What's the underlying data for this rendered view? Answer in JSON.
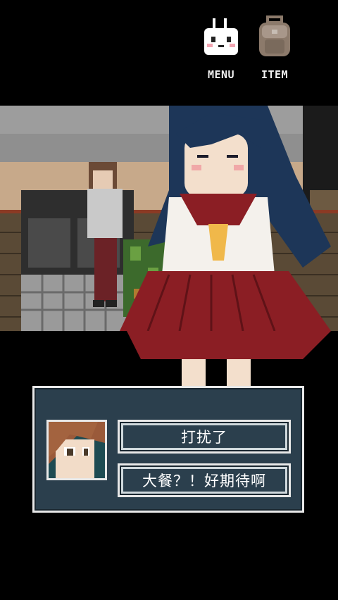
{
  "menu": {
    "label": "MENU"
  },
  "item": {
    "label": "ITEM"
  },
  "dialog": {
    "choices": [
      "打扰了",
      "大餐？！好期待啊"
    ]
  },
  "colors": {
    "panel": "#2b3f4d",
    "panel_border": "#e8e8e8",
    "skirt": "#8b1e24",
    "hair": "#1d3658"
  }
}
